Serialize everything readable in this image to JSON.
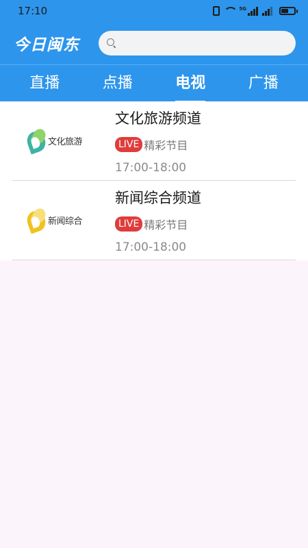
{
  "status_bar": {
    "time": "17:10",
    "network": "5G"
  },
  "header": {
    "app_name": "今日闽东",
    "search_placeholder": ""
  },
  "tabs": [
    {
      "label": "直播",
      "active": false
    },
    {
      "label": "点播",
      "active": false
    },
    {
      "label": "电视",
      "active": true
    },
    {
      "label": "广播",
      "active": false
    }
  ],
  "channels": [
    {
      "name": "文化旅游频道",
      "logo_text": "文化旅游",
      "live_label": "LIVE",
      "program": "精彩节目",
      "time": "17:00-18:00",
      "logo_color": "#3fb3a3"
    },
    {
      "name": "新闻综合频道",
      "logo_text": "新闻综合",
      "live_label": "LIVE",
      "program": "精彩节目",
      "time": "17:00-18:00",
      "logo_color": "#f0c21e"
    }
  ],
  "colors": {
    "primary": "#2d95ec",
    "live": "#e03c3c",
    "background": "#fbf5fb"
  }
}
